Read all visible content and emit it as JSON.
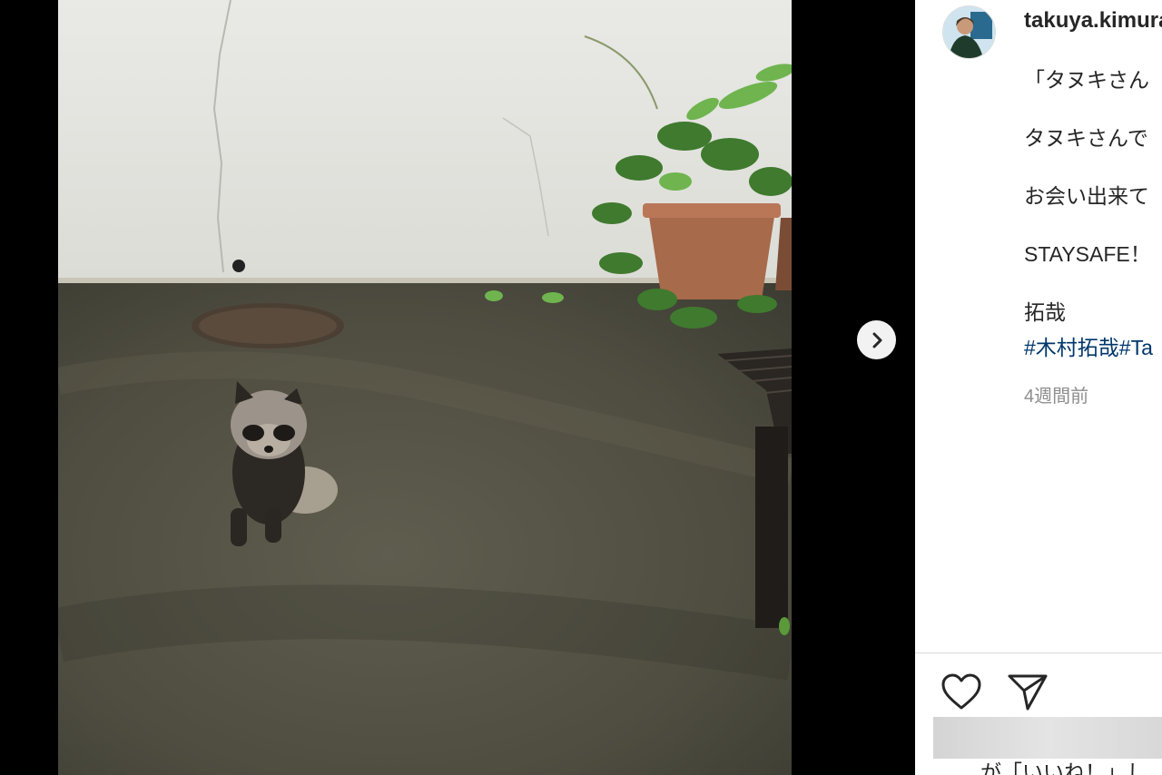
{
  "post": {
    "username": "takuya.kimura",
    "caption_lines": [
      "「タヌキさん",
      "タヌキさんで",
      "お会い出来て",
      "STAYSAFE！",
      "拓哉"
    ],
    "hashtags": [
      "#木村拓哉",
      "#Ta"
    ],
    "timestamp": "4週間前",
    "likes_text": "が「いいね！」し"
  },
  "media": {
    "alt": "Tanuki sitting on pavement in a courtyard",
    "next_icon": "chevron-right-icon"
  },
  "actions": {
    "like_icon": "heart-icon",
    "share_icon": "paper-plane-icon"
  }
}
